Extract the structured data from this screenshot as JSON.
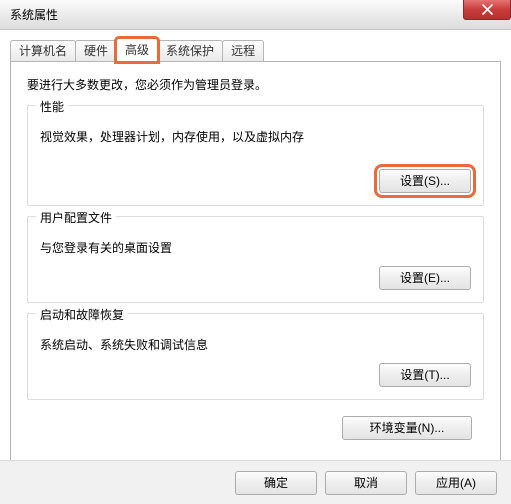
{
  "window": {
    "title": "系统属性"
  },
  "tabs": {
    "t0": "计算机名",
    "t1": "硬件",
    "t2": "高级",
    "t3": "系统保护",
    "t4": "远程"
  },
  "intro": "要进行大多数更改，您必须作为管理员登录。",
  "groups": {
    "performance": {
      "title": "性能",
      "desc": "视觉效果，处理器计划，内存使用，以及虚拟内存",
      "button": "设置(S)..."
    },
    "profiles": {
      "title": "用户配置文件",
      "desc": "与您登录有关的桌面设置",
      "button": "设置(E)..."
    },
    "startup": {
      "title": "启动和故障恢复",
      "desc": "系统启动、系统失败和调试信息",
      "button": "设置(T)..."
    }
  },
  "env_button": "环境变量(N)...",
  "bottom": {
    "ok": "确定",
    "cancel": "取消",
    "apply": "应用(A)"
  }
}
